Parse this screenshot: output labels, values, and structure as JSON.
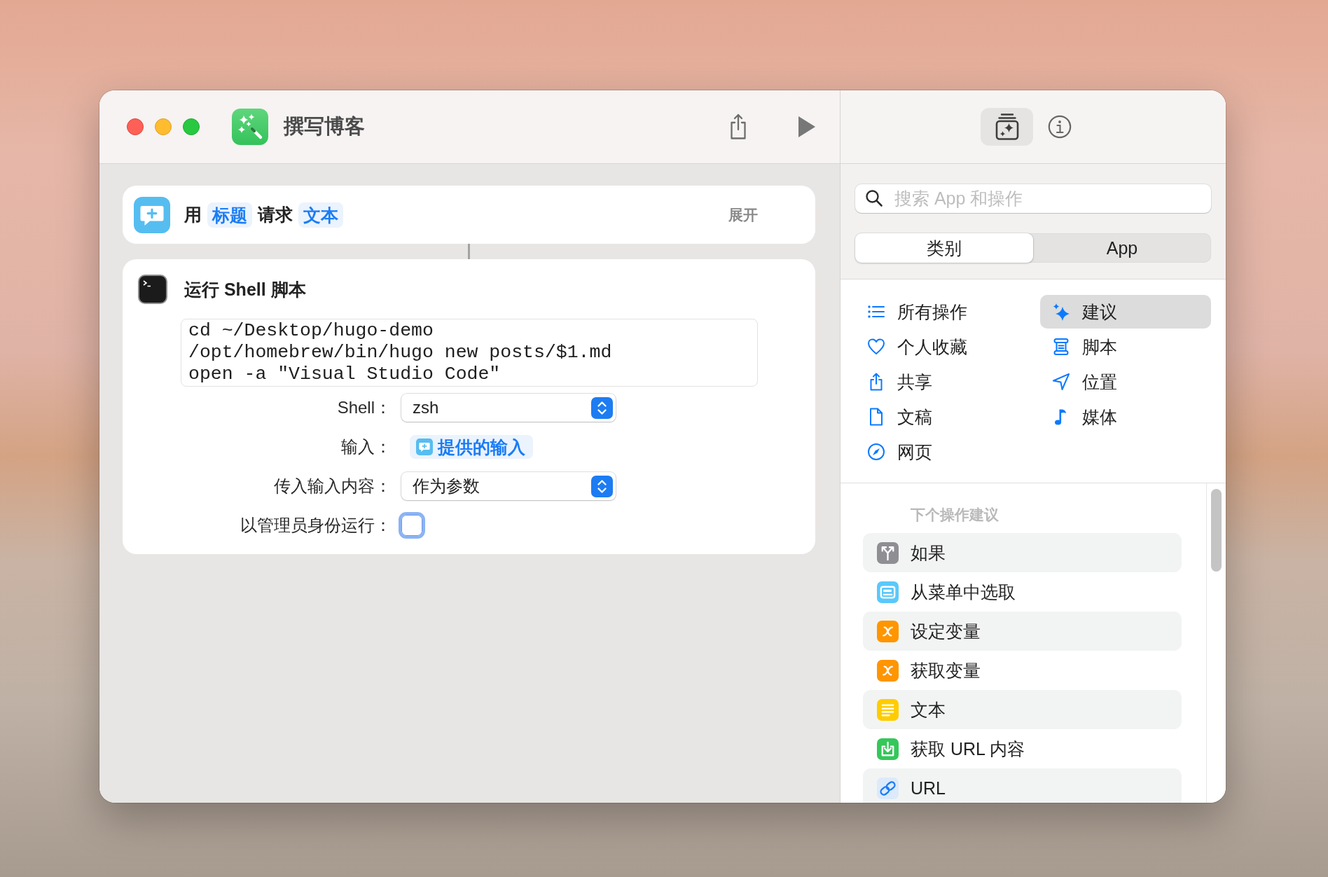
{
  "window": {
    "title": "撰写博客"
  },
  "actions": [
    {
      "kind": "ask",
      "sentence": [
        {
          "kind": "text",
          "text": "用"
        },
        {
          "kind": "token",
          "text": "标题"
        },
        {
          "kind": "text",
          "text": "请求"
        },
        {
          "kind": "token",
          "text": "文本"
        }
      ],
      "expand_label": "展开"
    },
    {
      "kind": "shell",
      "title": "运行 Shell 脚本",
      "script": [
        "cd ~/Desktop/hugo-demo",
        "/opt/homebrew/bin/hugo new posts/$1.md",
        "open -a \"Visual Studio Code\""
      ],
      "params": [
        {
          "kind": "popup",
          "label": "Shell：",
          "value": "zsh"
        },
        {
          "kind": "token",
          "label": "输入：",
          "value": "提供的输入"
        },
        {
          "kind": "popup",
          "label": "传入输入内容：",
          "value": "作为参数"
        },
        {
          "kind": "checkbox",
          "label": "以管理员身份运行：",
          "checked": false
        }
      ]
    }
  ],
  "sidebar": {
    "toolbar": [
      {
        "kind": "library",
        "selected": true
      },
      {
        "kind": "info",
        "selected": false
      }
    ],
    "search": {
      "placeholder": "搜索 App 和操作"
    },
    "segments": [
      {
        "label": "类别",
        "selected": true
      },
      {
        "label": "App",
        "selected": false
      }
    ],
    "categories": [
      {
        "kind": "all",
        "label": "所有操作",
        "selected": false
      },
      {
        "kind": "favorites",
        "label": "个人收藏",
        "selected": false
      },
      {
        "kind": "share",
        "label": "共享",
        "selected": false
      },
      {
        "kind": "documents",
        "label": "文稿",
        "selected": false
      },
      {
        "kind": "web",
        "label": "网页",
        "selected": false
      },
      {
        "kind": "suggestions",
        "label": "建议",
        "selected": true
      },
      {
        "kind": "scripting",
        "label": "脚本",
        "selected": false
      },
      {
        "kind": "location",
        "label": "位置",
        "selected": false
      },
      {
        "kind": "media",
        "label": "媒体",
        "selected": false
      }
    ],
    "suggestions": {
      "heading": "下个操作建议",
      "items": [
        {
          "kind": "if",
          "label": "如果",
          "color": "#8e8e93"
        },
        {
          "kind": "menu",
          "label": "从菜单中选取",
          "color": "#5ac8fa"
        },
        {
          "kind": "variable",
          "label": "设定变量",
          "color": "#ff9500"
        },
        {
          "kind": "variable",
          "label": "获取变量",
          "color": "#ff9500"
        },
        {
          "kind": "text",
          "label": "文本",
          "color": "#ffcc00"
        },
        {
          "kind": "download",
          "label": "获取 URL 内容",
          "color": "#34c759"
        },
        {
          "kind": "link",
          "label": "URL",
          "color": "#dceafa"
        }
      ]
    }
  }
}
